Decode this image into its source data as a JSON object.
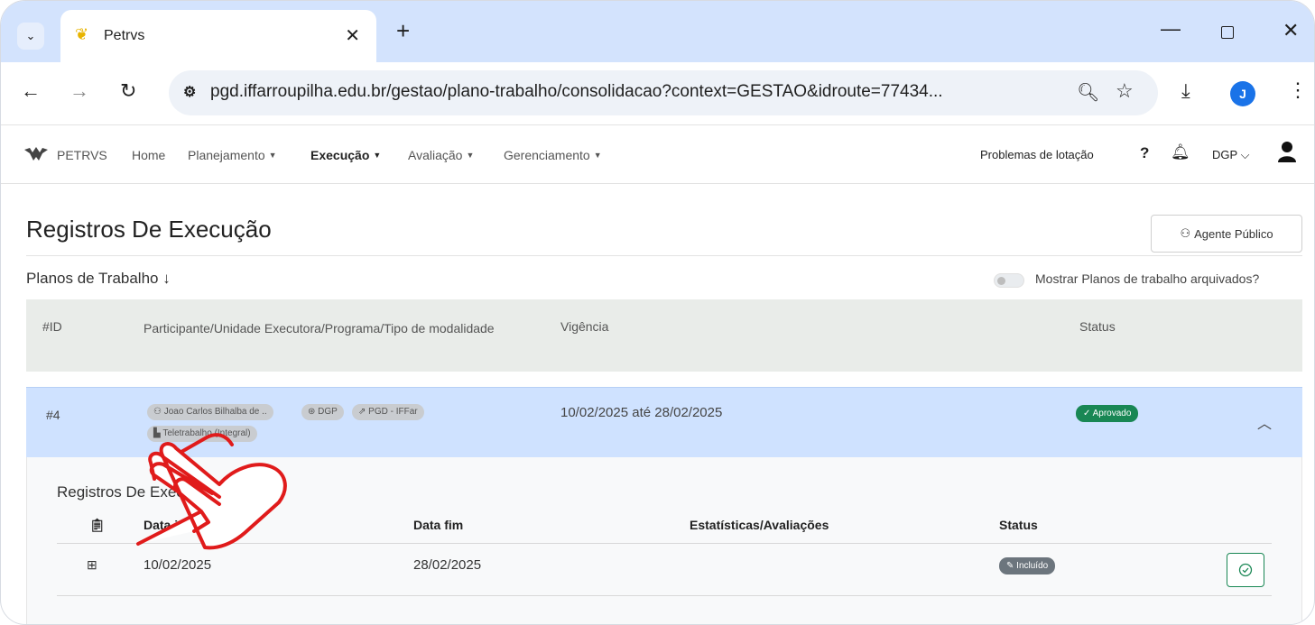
{
  "browser": {
    "tab_title": "Petrvs",
    "url": "pgd.iffarroupilha.edu.br/gestao/plano-trabalho/consolidacao?context=GESTAO&idroute=77434...",
    "profile_initial": "J"
  },
  "appnav": {
    "brand": "PETRVS",
    "menu": [
      "Home",
      "Planejamento",
      "Execução",
      "Avaliação",
      "Gerenciamento"
    ],
    "problems_link": "Problemas de lotação",
    "help": "?",
    "unit": "DGP"
  },
  "page": {
    "title": "Registros De Execução",
    "agent_button": "Agente Público",
    "section": "Planos de Trabalho ↓",
    "toggle_label": "Mostrar Planos de trabalho arquivados?"
  },
  "table": {
    "headers": {
      "id": "#ID",
      "participant": "Participante/Unidade Executora/Programa/Tipo de modalidade",
      "vigencia": "Vigência",
      "status": "Status"
    },
    "row": {
      "id": "#4",
      "participant": "Joao Carlos Bilhalba de ..",
      "unit": "DGP",
      "program": "PGD - IFFar",
      "modality": "Teletrabalho (Integral)",
      "vigencia": "10/02/2025 até 28/02/2025",
      "status": "Aprovado"
    }
  },
  "registros": {
    "title": "Registros De Execução",
    "headers": {
      "start": "Data início",
      "end": "Data fim",
      "stats": "Estatísticas/Avaliações",
      "status": "Status"
    },
    "rows": [
      {
        "start": "10/02/2025",
        "end": "28/02/2025",
        "status": "Incluído"
      }
    ]
  },
  "colors": {
    "tab_bar": "#d3e3fd",
    "selected_row": "#cfe2ff",
    "approved": "#198754",
    "included": "#6c757d",
    "hand_outline": "#e01b1b"
  }
}
